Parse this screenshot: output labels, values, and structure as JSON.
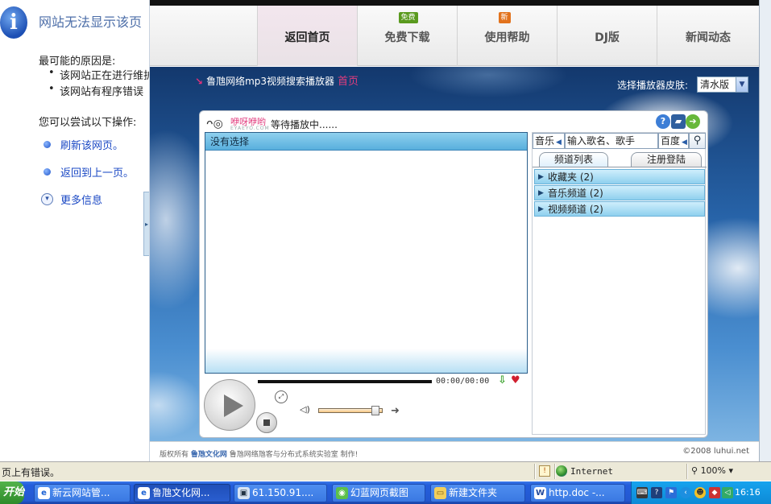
{
  "error_page": {
    "title": "网站无法显示该页",
    "causes_heading": "最可能的原因是:",
    "causes": [
      "该网站正在进行维护",
      "该网站有程序错误"
    ],
    "actions_heading": "您可以尝试以下操作:",
    "links": [
      "刷新该网页。",
      "返回到上一页。"
    ],
    "more_info": "更多信息"
  },
  "nav": {
    "items": [
      {
        "label": "返回首页",
        "badge": ""
      },
      {
        "label": "免费下载",
        "badge": "免费"
      },
      {
        "label": "使用帮助",
        "badge": "新"
      },
      {
        "label": "DJ版",
        "badge": ""
      },
      {
        "label": "新闻动态",
        "badge": ""
      }
    ]
  },
  "site": {
    "heading": "鲁虺网络mp3视频搜索播放器",
    "home_link": "首页",
    "skin_label": "选择播放器皮肤:",
    "skin_value": "清水版"
  },
  "player": {
    "logo_name": "咿呀咿哟",
    "logo_sub": "EYAEYO.COM",
    "status": "等待播放中......",
    "playlist_header": "没有选择",
    "time": "00:00/00:00",
    "search": {
      "type": "音乐",
      "query": "输入歌名、歌手",
      "engine": "百度"
    },
    "tabs": [
      "频道列表",
      "注册登陆"
    ],
    "channels": [
      "收藏夹 (2)",
      "音乐频道 (2)",
      "视频频道 (2)"
    ]
  },
  "footer": {
    "text_prefix": "版权所有",
    "brand": "鲁虺文化网",
    "text_suffix": "鲁虺网络虺客与分布式系统实验室 制作!",
    "copyright": "©2008 luhui.net"
  },
  "statusbar": {
    "text": "页上有错误。",
    "zone": "Internet",
    "zoom": "100%"
  },
  "taskbar": {
    "start": "开始",
    "tasks": [
      "新云网站管...",
      "鲁虺文化网...",
      "61.150.91....",
      "幻蓝网页截图",
      "新建文件夹",
      "http.doc -..."
    ],
    "clock": "16:16"
  },
  "colors": {
    "accent_pink": "#e23c7e",
    "sky_dark": "#13386d",
    "taskbar_blue": "#245edc"
  }
}
